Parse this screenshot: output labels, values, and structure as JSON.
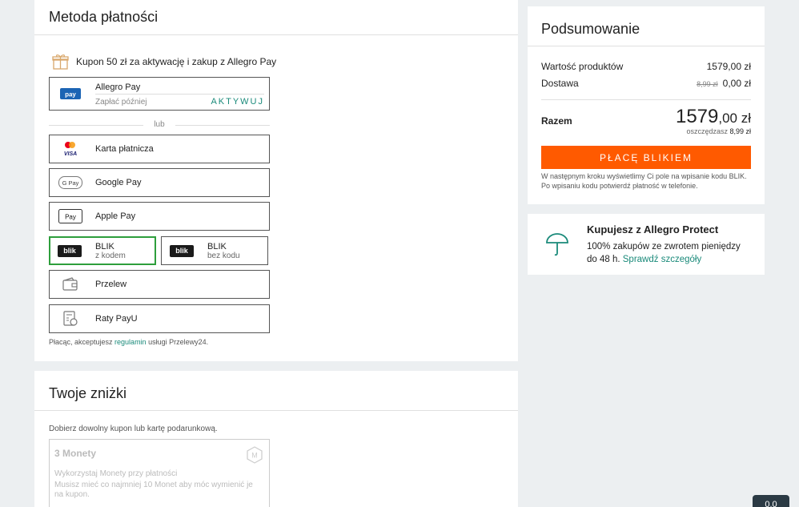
{
  "payment": {
    "title": "Metoda płatności",
    "coupon_text": "Kupon 50 zł za aktywację i zakup z Allegro Pay",
    "allegro_pay": {
      "label": "Allegro Pay",
      "sub": "Zapłać później",
      "activate": "AKTYWUJ"
    },
    "or_label": "lub",
    "options": {
      "card": "Karta płatnicza",
      "gpay": "Google Pay",
      "apay": "Apple Pay",
      "przelew": "Przelew",
      "payu": "Raty PayU"
    },
    "blik_kod": {
      "title": "BLIK",
      "sub": "z kodem"
    },
    "blik_bez": {
      "title": "BLIK",
      "sub": "bez kodu"
    },
    "blik_logo_text": "blik",
    "terms_prefix": "Płacąc, akceptujesz ",
    "terms_link": "regulamin",
    "terms_suffix": " usługi Przelewy24."
  },
  "discounts": {
    "title": "Twoje zniżki",
    "hint": "Dobierz dowolny kupon lub kartę podarunkową.",
    "monety_title": "3 Monety",
    "monety_sub": "Wykorzystaj Monety przy płatności",
    "monety_desc": "Musisz mieć co najmniej 10 Monet aby móc wymienić je na kupon."
  },
  "summary": {
    "title": "Podsumowanie",
    "products_label": "Wartość produktów",
    "products_value": "1579,00 zł",
    "shipping_label": "Dostawa",
    "shipping_old": "8,99 zł",
    "shipping_value": "0,00 zł",
    "total_label": "Razem",
    "total_main": "1579",
    "total_cents": ",00 zł",
    "save_prefix": "oszczędzasz ",
    "save_value": "8,99 zł",
    "pay_button": "PŁACĘ BLIKIEM",
    "blik_note": "W następnym kroku wyświetlimy Ci pole na wpisanie kodu BLIK. Po wpisaniu kodu potwierdź płatność w telefonie."
  },
  "protect": {
    "title": "Kupujesz z Allegro Protect",
    "text": "100% zakupów ze zwrotem pieniędzy do 48 h. ",
    "link": "Sprawdź szczegóły"
  },
  "corner": {
    "label": "0.0"
  },
  "colors": {
    "accent": "#ff5a00",
    "link": "#1a8a7a",
    "selected": "#2e9e3c"
  }
}
